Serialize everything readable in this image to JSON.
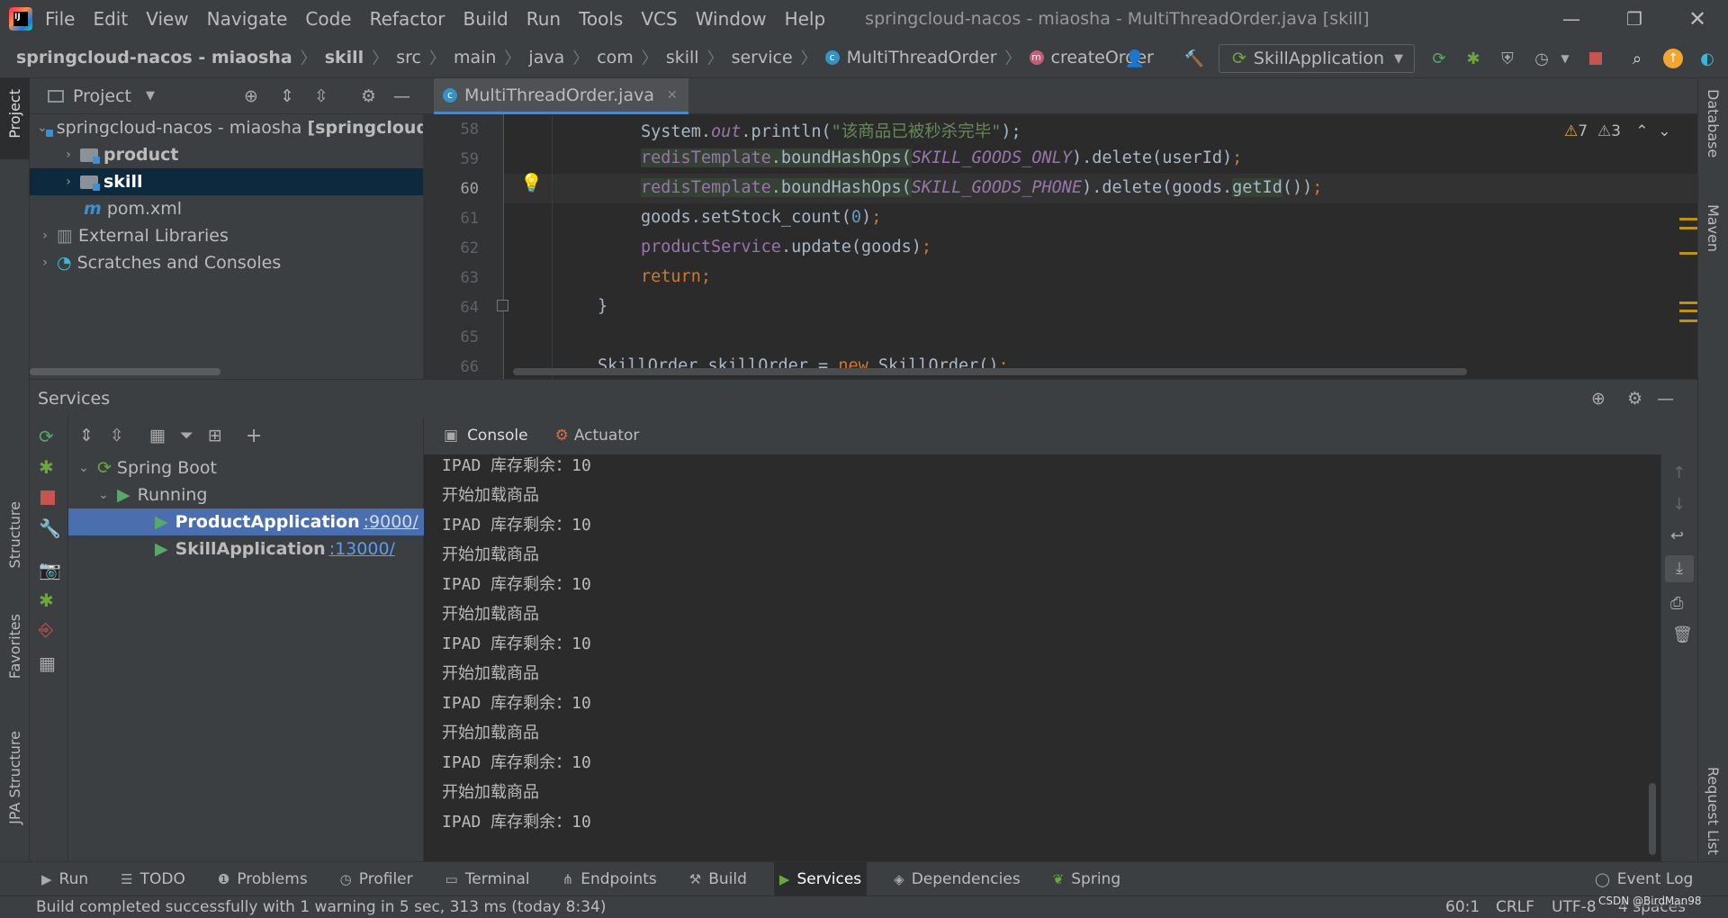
{
  "menu": [
    "File",
    "Edit",
    "View",
    "Navigate",
    "Code",
    "Refactor",
    "Build",
    "Run",
    "Tools",
    "VCS",
    "Window",
    "Help"
  ],
  "window_title": "springcloud-nacos - miaosha - MultiThreadOrder.java [skill]",
  "breadcrumb": [
    "springcloud-nacos - miaosha",
    "skill",
    "src",
    "main",
    "java",
    "com",
    "skill",
    "service",
    "MultiThreadOrder",
    "createOrder"
  ],
  "run_config": "SkillApplication",
  "project": {
    "header": "Project",
    "root": "springcloud-nacos - miaosha",
    "root_suffix": "[springcloud",
    "items": [
      "product",
      "skill",
      "pom.xml",
      "External Libraries",
      "Scratches and Consoles"
    ]
  },
  "editor": {
    "tab": "MultiThreadOrder.java",
    "line_numbers": [
      "58",
      "59",
      "60",
      "61",
      "62",
      "63",
      "64",
      "65",
      "66"
    ],
    "warnings": "7",
    "weak_warnings": "3",
    "lines": {
      "l58_a": "System.",
      "l58_b": "out",
      "l58_c": ".println(",
      "l58_str": "\"该商品已被秒杀完毕\"",
      "l58_d": ");",
      "l59_a": "redisTemplate",
      "l59_b": ".boundHashOps(",
      "l59_c": "SKILL_GOODS_ONLY",
      "l59_d": ").delete(userId)",
      "l59_e": ";",
      "l60_a": "redisTemplate",
      "l60_b": ".boundHashOps(",
      "l60_c": "SKILL_GOODS_PHONE",
      "l60_d": ").delete(goods.",
      "l60_e": "getId",
      "l60_f": "())",
      "l60_g": ";",
      "l61_a": "goods.setStock_count(",
      "l61_b": "0",
      "l61_c": ")",
      "l61_d": ";",
      "l62_a": "productService",
      "l62_b": ".update(goods)",
      "l62_c": ";",
      "l63": "return;",
      "l64": "}",
      "l66_a": "SkillOrder skillOrder = ",
      "l66_b": "new",
      "l66_c": " SkillOrder()",
      "l66_d": ";"
    }
  },
  "services": {
    "header": "Services",
    "tree": {
      "spring_boot": "Spring Boot",
      "running": "Running",
      "apps": [
        {
          "name": "ProductApplication",
          "port": ":9000/"
        },
        {
          "name": "SkillApplication",
          "port": ":13000/"
        }
      ]
    },
    "tabs": [
      "Console",
      "Actuator"
    ],
    "console_lines": [
      "IPAD 库存剩余：10",
      "开始加载商品",
      "IPAD 库存剩余：10",
      "开始加载商品",
      "IPAD 库存剩余：10",
      "开始加载商品",
      "IPAD 库存剩余：10",
      "开始加载商品",
      "IPAD 库存剩余：10",
      "开始加载商品",
      "IPAD 库存剩余：10",
      "开始加载商品",
      "IPAD 库存剩余：10"
    ]
  },
  "side_left": [
    "Project",
    "Structure",
    "Favorites",
    "JPA Structure"
  ],
  "side_right": [
    "Database",
    "Maven",
    "Request List"
  ],
  "tool_windows": [
    "Run",
    "TODO",
    "Problems",
    "Profiler",
    "Terminal",
    "Endpoints",
    "Build",
    "Services",
    "Dependencies",
    "Spring"
  ],
  "event_log": "Event Log",
  "status": {
    "message": "Build completed successfully with 1 warning in 5 sec, 313 ms (today 8:34)",
    "position": "60:1",
    "line_sep": "CRLF",
    "encoding": "UTF-8",
    "indent": "4 spaces",
    "watermark": "CSDN @BirdMan98"
  }
}
